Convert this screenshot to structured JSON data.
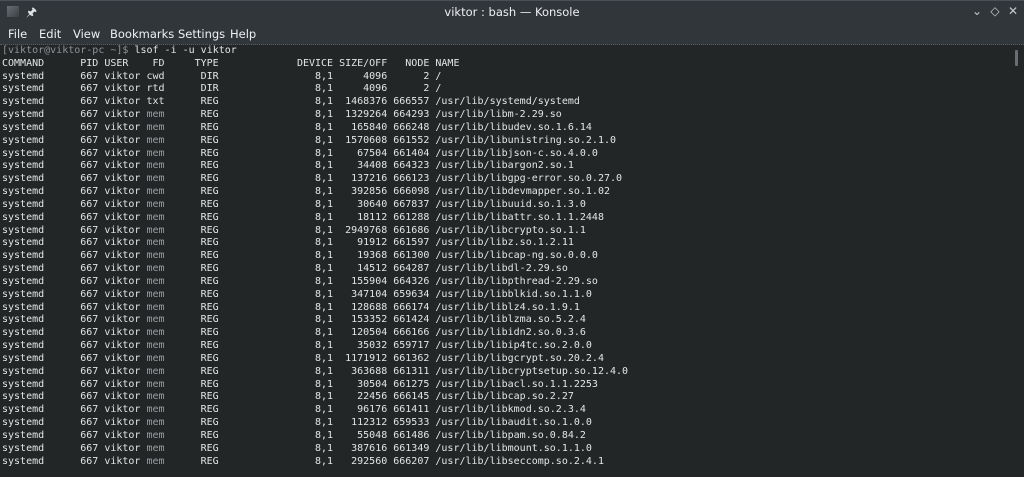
{
  "window": {
    "title": "viktor : bash — Konsole",
    "controls": [
      "minimize",
      "maximize",
      "close"
    ]
  },
  "menu": [
    "File",
    "Edit",
    "View",
    "Bookmarks",
    "Settings",
    "Help"
  ],
  "terminal": {
    "prompt": "[viktor@viktor-pc ~]$",
    "command": " lsof -i -u viktor",
    "headers": [
      "COMMAND",
      "PID",
      "USER",
      "FD",
      "TYPE",
      "DEVICE",
      "SIZE/OFF",
      "NODE",
      "NAME"
    ],
    "rows": [
      [
        "systemd",
        "667",
        "viktor",
        "cwd",
        "DIR",
        "8,1",
        "4096",
        "2",
        "/"
      ],
      [
        "systemd",
        "667",
        "viktor",
        "rtd",
        "DIR",
        "8,1",
        "4096",
        "2",
        "/"
      ],
      [
        "systemd",
        "667",
        "viktor",
        "txt",
        "REG",
        "8,1",
        "1468376",
        "666557",
        "/usr/lib/systemd/systemd"
      ],
      [
        "systemd",
        "667",
        "viktor",
        "mem",
        "REG",
        "8,1",
        "1329264",
        "664293",
        "/usr/lib/libm-2.29.so"
      ],
      [
        "systemd",
        "667",
        "viktor",
        "mem",
        "REG",
        "8,1",
        "165840",
        "666248",
        "/usr/lib/libudev.so.1.6.14"
      ],
      [
        "systemd",
        "667",
        "viktor",
        "mem",
        "REG",
        "8,1",
        "1570608",
        "661552",
        "/usr/lib/libunistring.so.2.1.0"
      ],
      [
        "systemd",
        "667",
        "viktor",
        "mem",
        "REG",
        "8,1",
        "67504",
        "661404",
        "/usr/lib/libjson-c.so.4.0.0"
      ],
      [
        "systemd",
        "667",
        "viktor",
        "mem",
        "REG",
        "8,1",
        "34408",
        "664323",
        "/usr/lib/libargon2.so.1"
      ],
      [
        "systemd",
        "667",
        "viktor",
        "mem",
        "REG",
        "8,1",
        "137216",
        "666123",
        "/usr/lib/libgpg-error.so.0.27.0"
      ],
      [
        "systemd",
        "667",
        "viktor",
        "mem",
        "REG",
        "8,1",
        "392856",
        "666098",
        "/usr/lib/libdevmapper.so.1.02"
      ],
      [
        "systemd",
        "667",
        "viktor",
        "mem",
        "REG",
        "8,1",
        "30640",
        "667837",
        "/usr/lib/libuuid.so.1.3.0"
      ],
      [
        "systemd",
        "667",
        "viktor",
        "mem",
        "REG",
        "8,1",
        "18112",
        "661288",
        "/usr/lib/libattr.so.1.1.2448"
      ],
      [
        "systemd",
        "667",
        "viktor",
        "mem",
        "REG",
        "8,1",
        "2949768",
        "661686",
        "/usr/lib/libcrypto.so.1.1"
      ],
      [
        "systemd",
        "667",
        "viktor",
        "mem",
        "REG",
        "8,1",
        "91912",
        "661597",
        "/usr/lib/libz.so.1.2.11"
      ],
      [
        "systemd",
        "667",
        "viktor",
        "mem",
        "REG",
        "8,1",
        "19368",
        "661300",
        "/usr/lib/libcap-ng.so.0.0.0"
      ],
      [
        "systemd",
        "667",
        "viktor",
        "mem",
        "REG",
        "8,1",
        "14512",
        "664287",
        "/usr/lib/libdl-2.29.so"
      ],
      [
        "systemd",
        "667",
        "viktor",
        "mem",
        "REG",
        "8,1",
        "155904",
        "664326",
        "/usr/lib/libpthread-2.29.so"
      ],
      [
        "systemd",
        "667",
        "viktor",
        "mem",
        "REG",
        "8,1",
        "347104",
        "659634",
        "/usr/lib/libblkid.so.1.1.0"
      ],
      [
        "systemd",
        "667",
        "viktor",
        "mem",
        "REG",
        "8,1",
        "128688",
        "666174",
        "/usr/lib/liblz4.so.1.9.1"
      ],
      [
        "systemd",
        "667",
        "viktor",
        "mem",
        "REG",
        "8,1",
        "153352",
        "661424",
        "/usr/lib/liblzma.so.5.2.4"
      ],
      [
        "systemd",
        "667",
        "viktor",
        "mem",
        "REG",
        "8,1",
        "120504",
        "666166",
        "/usr/lib/libidn2.so.0.3.6"
      ],
      [
        "systemd",
        "667",
        "viktor",
        "mem",
        "REG",
        "8,1",
        "35032",
        "659717",
        "/usr/lib/libip4tc.so.2.0.0"
      ],
      [
        "systemd",
        "667",
        "viktor",
        "mem",
        "REG",
        "8,1",
        "1171912",
        "661362",
        "/usr/lib/libgcrypt.so.20.2.4"
      ],
      [
        "systemd",
        "667",
        "viktor",
        "mem",
        "REG",
        "8,1",
        "363688",
        "661311",
        "/usr/lib/libcryptsetup.so.12.4.0"
      ],
      [
        "systemd",
        "667",
        "viktor",
        "mem",
        "REG",
        "8,1",
        "30504",
        "661275",
        "/usr/lib/libacl.so.1.1.2253"
      ],
      [
        "systemd",
        "667",
        "viktor",
        "mem",
        "REG",
        "8,1",
        "22456",
        "666145",
        "/usr/lib/libcap.so.2.27"
      ],
      [
        "systemd",
        "667",
        "viktor",
        "mem",
        "REG",
        "8,1",
        "96176",
        "661411",
        "/usr/lib/libkmod.so.2.3.4"
      ],
      [
        "systemd",
        "667",
        "viktor",
        "mem",
        "REG",
        "8,1",
        "112312",
        "659533",
        "/usr/lib/libaudit.so.1.0.0"
      ],
      [
        "systemd",
        "667",
        "viktor",
        "mem",
        "REG",
        "8,1",
        "55048",
        "661486",
        "/usr/lib/libpam.so.0.84.2"
      ],
      [
        "systemd",
        "667",
        "viktor",
        "mem",
        "REG",
        "8,1",
        "387616",
        "661349",
        "/usr/lib/libmount.so.1.1.0"
      ],
      [
        "systemd",
        "667",
        "viktor",
        "mem",
        "REG",
        "8,1",
        "292560",
        "666207",
        "/usr/lib/libseccomp.so.2.4.1"
      ]
    ]
  }
}
